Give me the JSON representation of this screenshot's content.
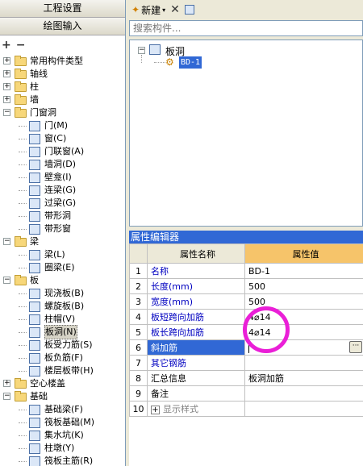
{
  "left_panel": {
    "header1": "工程设置",
    "header2": "绘图输入",
    "tree": [
      {
        "label": "常用构件类型",
        "type": "folder",
        "expander": "+"
      },
      {
        "label": "轴线",
        "type": "folder",
        "expander": "+"
      },
      {
        "label": "柱",
        "type": "folder",
        "expander": "+"
      },
      {
        "label": "墙",
        "type": "folder",
        "expander": "+"
      },
      {
        "label": "门窗洞",
        "type": "folder",
        "expander": "-"
      },
      {
        "label": "门(M)",
        "type": "item",
        "icon": "door-icon"
      },
      {
        "label": "窗(C)",
        "type": "item",
        "icon": "window-icon"
      },
      {
        "label": "门联窗(A)",
        "type": "item",
        "icon": "door-window-icon"
      },
      {
        "label": "墙洞(D)",
        "type": "item",
        "icon": "wall-hole-icon"
      },
      {
        "label": "壁龛(I)",
        "type": "item",
        "icon": "niche-icon"
      },
      {
        "label": "连梁(G)",
        "type": "item",
        "icon": "link-beam-icon"
      },
      {
        "label": "过梁(G)",
        "type": "item",
        "icon": "lintel-icon"
      },
      {
        "label": "带形洞",
        "type": "item",
        "icon": "strip-hole-icon"
      },
      {
        "label": "带形窗",
        "type": "item",
        "icon": "strip-window-icon"
      },
      {
        "label": "梁",
        "type": "folder",
        "expander": "-"
      },
      {
        "label": "梁(L)",
        "type": "item",
        "icon": "beam-icon"
      },
      {
        "label": "圈梁(E)",
        "type": "item",
        "icon": "ring-beam-icon"
      },
      {
        "label": "板",
        "type": "folder",
        "expander": "-"
      },
      {
        "label": "现浇板(B)",
        "type": "item",
        "icon": "cast-slab-icon"
      },
      {
        "label": "螺旋板(B)",
        "type": "item",
        "icon": "spiral-slab-icon"
      },
      {
        "label": "柱帽(V)",
        "type": "item",
        "icon": "column-cap-icon"
      },
      {
        "label": "板洞(N)",
        "type": "item",
        "icon": "slab-hole-icon",
        "selected": true
      },
      {
        "label": "板受力筋(S)",
        "type": "item",
        "icon": "slab-rebar-icon"
      },
      {
        "label": "板负筋(F)",
        "type": "item",
        "icon": "negative-rebar-icon"
      },
      {
        "label": "楼层板带(H)",
        "type": "item",
        "icon": "slab-band-icon"
      },
      {
        "label": "空心楼盖",
        "type": "folder",
        "expander": "+"
      },
      {
        "label": "基础",
        "type": "folder",
        "expander": "-"
      },
      {
        "label": "基础梁(F)",
        "type": "item",
        "icon": "foundation-beam-icon"
      },
      {
        "label": "筏板基础(M)",
        "type": "item",
        "icon": "raft-icon"
      },
      {
        "label": "集水坑(K)",
        "type": "item",
        "icon": "sump-icon"
      },
      {
        "label": "柱墩(Y)",
        "type": "item",
        "icon": "pier-icon"
      },
      {
        "label": "筏板主筋(R)",
        "type": "item",
        "icon": "raft-rebar-icon"
      }
    ]
  },
  "toolbar": {
    "new_label": "新建"
  },
  "search": {
    "placeholder": "搜索构件..."
  },
  "component_tree": {
    "root": "板洞",
    "child": "BD-1"
  },
  "property_editor": {
    "title": "属性编辑器",
    "col_name": "属性名称",
    "col_value": "属性值",
    "rows": [
      {
        "num": "1",
        "name": "名称",
        "value": "BD-1",
        "name_color": "blue"
      },
      {
        "num": "2",
        "name": "长度(mm)",
        "value": "500",
        "name_color": "blue"
      },
      {
        "num": "3",
        "name": "宽度(mm)",
        "value": "500",
        "name_color": "blue"
      },
      {
        "num": "4",
        "name": "板短跨向加筋",
        "value": "4⌀14",
        "name_color": "blue"
      },
      {
        "num": "5",
        "name": "板长跨向加筋",
        "value": "4⌀14",
        "name_color": "blue"
      },
      {
        "num": "6",
        "name": "斜加筋",
        "value": "",
        "name_color": "selected"
      },
      {
        "num": "7",
        "name": "其它钢筋",
        "value": "",
        "name_color": "blue"
      },
      {
        "num": "8",
        "name": "汇总信息",
        "value": "板洞加筋",
        "name_color": "black"
      },
      {
        "num": "9",
        "name": "备注",
        "value": "",
        "name_color": "black"
      },
      {
        "num": "10",
        "name": "显示样式",
        "value": "",
        "name_color": "gray"
      }
    ]
  },
  "colors": {
    "highlight_circle": "#ea1fd7",
    "selection": "#3168d5",
    "header_value": "#f6c46a"
  }
}
